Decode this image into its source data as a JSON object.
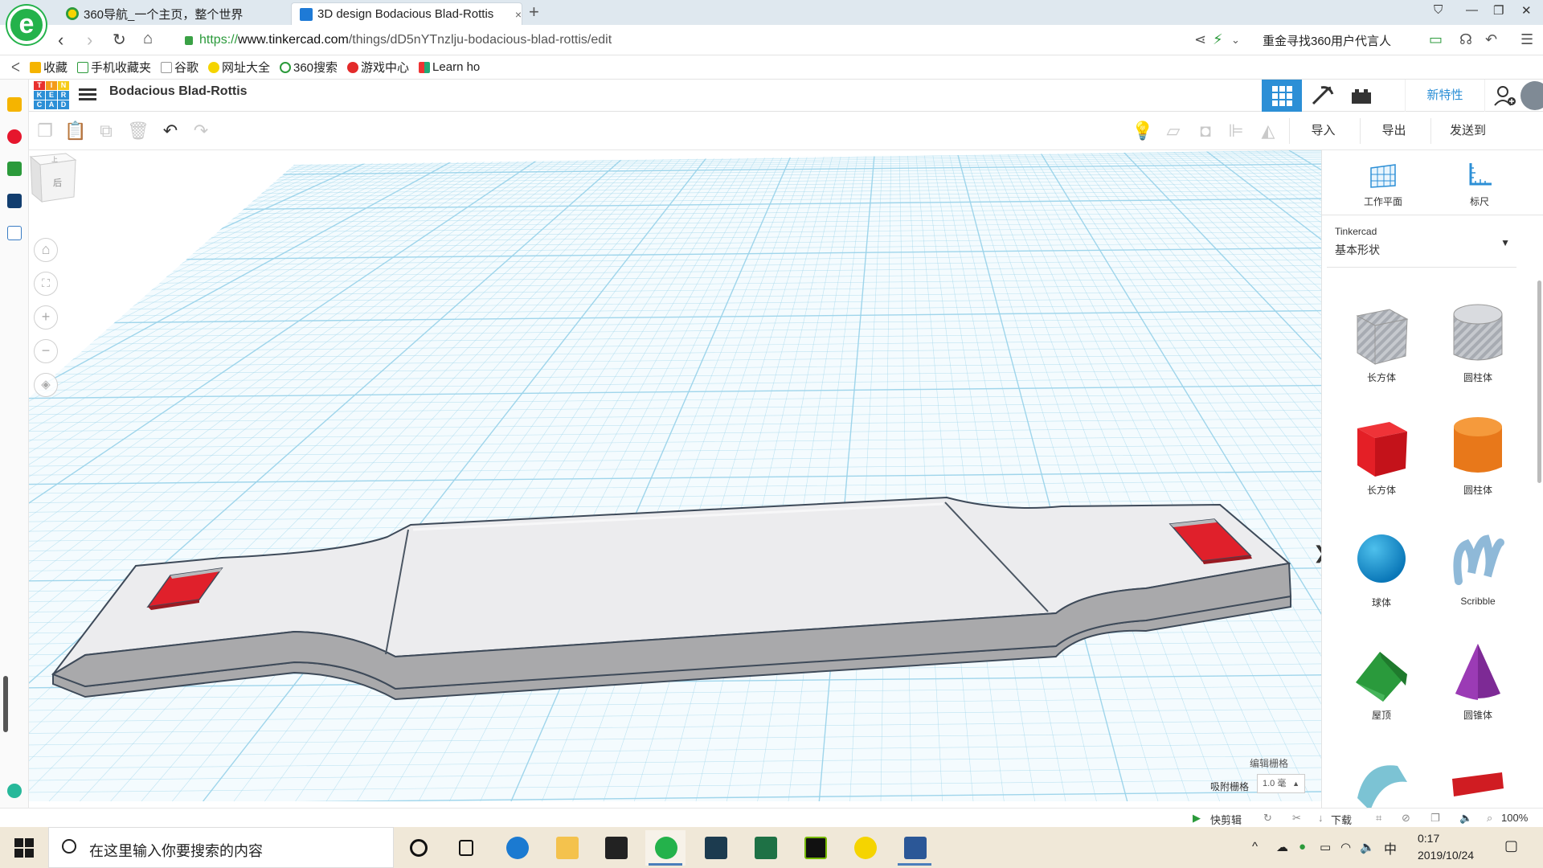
{
  "browser": {
    "logo_letter": "e",
    "tabs": [
      {
        "title": "360导航_一个主页，整个世界"
      },
      {
        "title": "3D design Bodacious Blad-Rottis",
        "close": "×"
      }
    ],
    "new_tab": "+",
    "window_controls": [
      "⛉",
      "—",
      "❐",
      "✕"
    ],
    "url": {
      "scheme": "https://",
      "domain": "www.tinkercad.com",
      "path": "/things/dD5nYTnzlju-bodacious-blad-rottis/edit"
    },
    "search_hint": "重金寻找360用户代言人",
    "bookmarks": [
      "收藏",
      "手机收藏夹",
      "谷歌",
      "网址大全",
      "360搜索",
      "游戏中心",
      "Learn ho"
    ]
  },
  "app": {
    "logo_letters": [
      "T",
      "I",
      "N",
      "K",
      "E",
      "R",
      "C",
      "A",
      "D"
    ],
    "design_title": "Bodacious Blad-Rottis",
    "new_features": "新特性",
    "toolbar": {
      "import": "导入",
      "export": "导出",
      "send_to": "发送到"
    },
    "viewcube": {
      "top_label": "上",
      "back_label": "后"
    },
    "view_controls": {
      "home": "⌂",
      "fit": "⛶",
      "zoom_in": "+",
      "zoom_out": "−",
      "perspective": "◈"
    },
    "snap": {
      "edit_grid": "编辑栅格",
      "snap_grid": "吸附栅格",
      "value": "1.0 毫",
      "caret": "▲"
    },
    "panel_toggle": "❯",
    "right_panel": {
      "tools": [
        {
          "label": "工作平面"
        },
        {
          "label": "标尺"
        }
      ],
      "library": {
        "source": "Tinkercad",
        "name": "基本形状",
        "caret": "▼"
      },
      "shapes": [
        {
          "label": "长方体",
          "icon": "box-hole-icon"
        },
        {
          "label": "圆柱体",
          "icon": "cylinder-hole-icon"
        },
        {
          "label": "长方体",
          "icon": "box-red-icon"
        },
        {
          "label": "圆柱体",
          "icon": "cylinder-orange-icon"
        },
        {
          "label": "球体",
          "icon": "sphere-blue-icon"
        },
        {
          "label": "Scribble",
          "icon": "scribble-icon"
        },
        {
          "label": "屋顶",
          "icon": "roof-green-icon"
        },
        {
          "label": "圆锥体",
          "icon": "cone-purple-icon"
        }
      ]
    },
    "colors": {
      "accent": "#2c8fd6",
      "grid_line": "#9ad3ea",
      "plate_top": "#ececee",
      "plate_side": "#a8a8aa",
      "red_hole": "#e0202b"
    }
  },
  "statusbar": {
    "quick_clip": "快剪辑",
    "download": "下载",
    "zoom": "100%"
  },
  "taskbar": {
    "search_placeholder": "在这里输入你要搜索的内容",
    "time": "0:17",
    "date": "2019/10/24",
    "ime": "中"
  }
}
